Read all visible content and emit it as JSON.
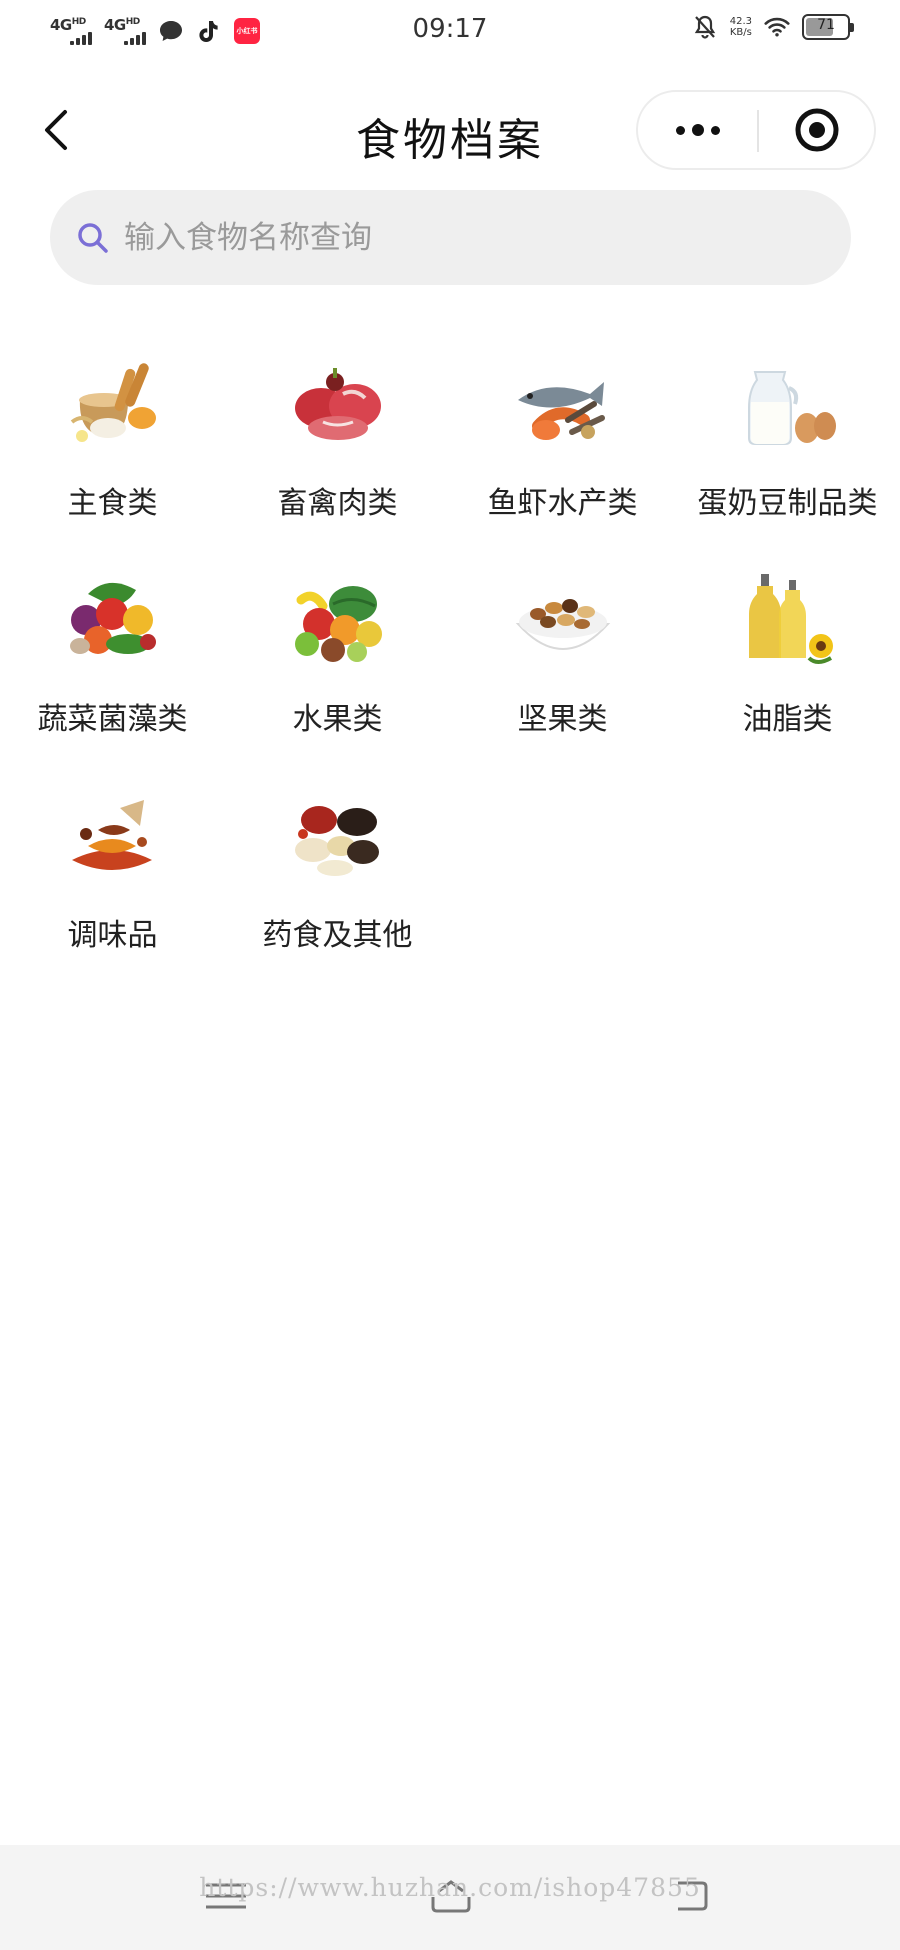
{
  "status_bar": {
    "time": "09:17",
    "signal_1": "4G",
    "signal_1_sup": "HD",
    "signal_2": "4G",
    "signal_2_sup": "HD",
    "app_badge": "小红书",
    "net_speed_value": "42.3",
    "net_speed_unit": "KB/s",
    "battery": "71",
    "battery_level": 0.71,
    "icons": [
      "signal-4g-icon",
      "signal-4g-icon",
      "chat-bubble-icon",
      "tiktok-icon",
      "rednote-app-icon",
      "bell-off-icon",
      "wifi-icon",
      "battery-icon"
    ]
  },
  "nav": {
    "title": "食物档案",
    "icons": [
      "back-arrow-icon",
      "more-dots-icon",
      "close-target-icon"
    ]
  },
  "search": {
    "placeholder": "输入食物名称查询",
    "icon": "search-icon",
    "accent_color": "#7b6fd6"
  },
  "categories": [
    {
      "label": "主食类",
      "icon": "staple-food-icon"
    },
    {
      "label": "畜禽肉类",
      "icon": "meat-icon"
    },
    {
      "label": "鱼虾水产类",
      "icon": "seafood-icon"
    },
    {
      "label": "蛋奶豆制品类",
      "icon": "egg-milk-icon"
    },
    {
      "label": "蔬菜菌藻类",
      "icon": "vegetable-icon"
    },
    {
      "label": "水果类",
      "icon": "fruit-icon"
    },
    {
      "label": "坚果类",
      "icon": "nut-icon"
    },
    {
      "label": "油脂类",
      "icon": "oil-icon"
    },
    {
      "label": "调味品",
      "icon": "spice-icon"
    },
    {
      "label": "药食及其他",
      "icon": "herb-icon"
    }
  ],
  "system_nav": {
    "watermark": "https://www.huzhan.com/ishop47855",
    "icons": [
      "menu-icon",
      "home-icon",
      "back-icon"
    ]
  }
}
